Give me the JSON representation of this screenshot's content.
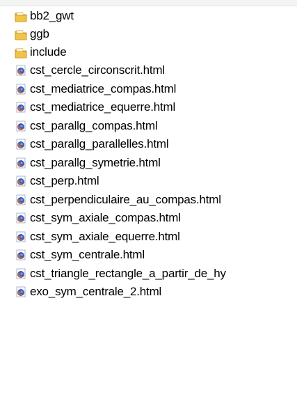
{
  "files": [
    {
      "name": "bb2_gwt",
      "icon": "folder-icon"
    },
    {
      "name": "ggb",
      "icon": "folder-icon"
    },
    {
      "name": "include",
      "icon": "folder-icon"
    },
    {
      "name": "cst_cercle_circonscrit.html",
      "icon": "firefox-html-icon"
    },
    {
      "name": "cst_mediatrice_compas.html",
      "icon": "firefox-html-icon"
    },
    {
      "name": "cst_mediatrice_equerre.html",
      "icon": "firefox-html-icon"
    },
    {
      "name": "cst_parallg_compas.html",
      "icon": "firefox-html-icon"
    },
    {
      "name": "cst_parallg_parallelles.html",
      "icon": "firefox-html-icon"
    },
    {
      "name": "cst_parallg_symetrie.html",
      "icon": "firefox-html-icon"
    },
    {
      "name": "cst_perp.html",
      "icon": "firefox-html-icon"
    },
    {
      "name": "cst_perpendiculaire_au_compas.html",
      "icon": "firefox-html-icon"
    },
    {
      "name": "cst_sym_axiale_compas.html",
      "icon": "firefox-html-icon"
    },
    {
      "name": "cst_sym_axiale_equerre.html",
      "icon": "firefox-html-icon"
    },
    {
      "name": "cst_sym_centrale.html",
      "icon": "firefox-html-icon"
    },
    {
      "name": "cst_triangle_rectangle_a_partir_de_hy",
      "icon": "firefox-html-icon"
    },
    {
      "name": "exo_sym_centrale_2.html",
      "icon": "firefox-html-icon"
    }
  ],
  "colors": {
    "folder": "#e8b93a",
    "folder_dark": "#c9901c",
    "firefox_orange": "#e8621b",
    "firefox_blue": "#3a5fb8"
  }
}
